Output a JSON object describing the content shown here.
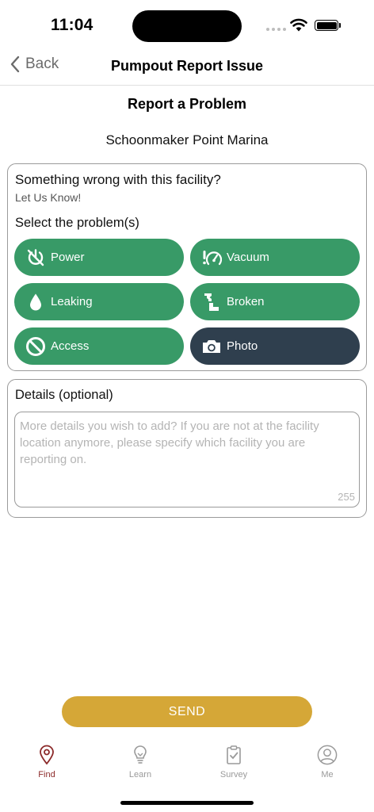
{
  "status_bar": {
    "time": "11:04"
  },
  "nav": {
    "back_label": "Back",
    "title": "Pumpout Report Issue"
  },
  "page": {
    "heading": "Report a Problem",
    "facility_name": "Schoonmaker Point Marina"
  },
  "problem_card": {
    "question": "Something wrong with this facility?",
    "subtitle": "Let Us Know!",
    "select_label": "Select the problem(s)",
    "options": [
      {
        "label": "Power",
        "icon": "power-off-icon"
      },
      {
        "label": "Vacuum",
        "icon": "vacuum-gauge-icon"
      },
      {
        "label": "Leaking",
        "icon": "droplet-icon"
      },
      {
        "label": "Broken",
        "icon": "broken-pipe-icon"
      },
      {
        "label": "Access",
        "icon": "no-access-icon"
      },
      {
        "label": "Photo",
        "icon": "camera-icon"
      }
    ]
  },
  "details": {
    "label": "Details (optional)",
    "placeholder": "More details you wish to add? If you are not at the facility location anymore, please specify which facility you are reporting on.",
    "char_count": "255"
  },
  "send_label": "SEND",
  "tabs": [
    {
      "label": "Find",
      "icon": "map-pin-icon",
      "active": true
    },
    {
      "label": "Learn",
      "icon": "lightbulb-icon",
      "active": false
    },
    {
      "label": "Survey",
      "icon": "clipboard-check-icon",
      "active": false
    },
    {
      "label": "Me",
      "icon": "user-circle-icon",
      "active": false
    }
  ],
  "colors": {
    "option_green": "#389a67",
    "photo_dark": "#2f3f4e",
    "send_gold": "#d5a737",
    "tab_active": "#8c2a2a",
    "tab_inactive": "#9a9a9a"
  }
}
